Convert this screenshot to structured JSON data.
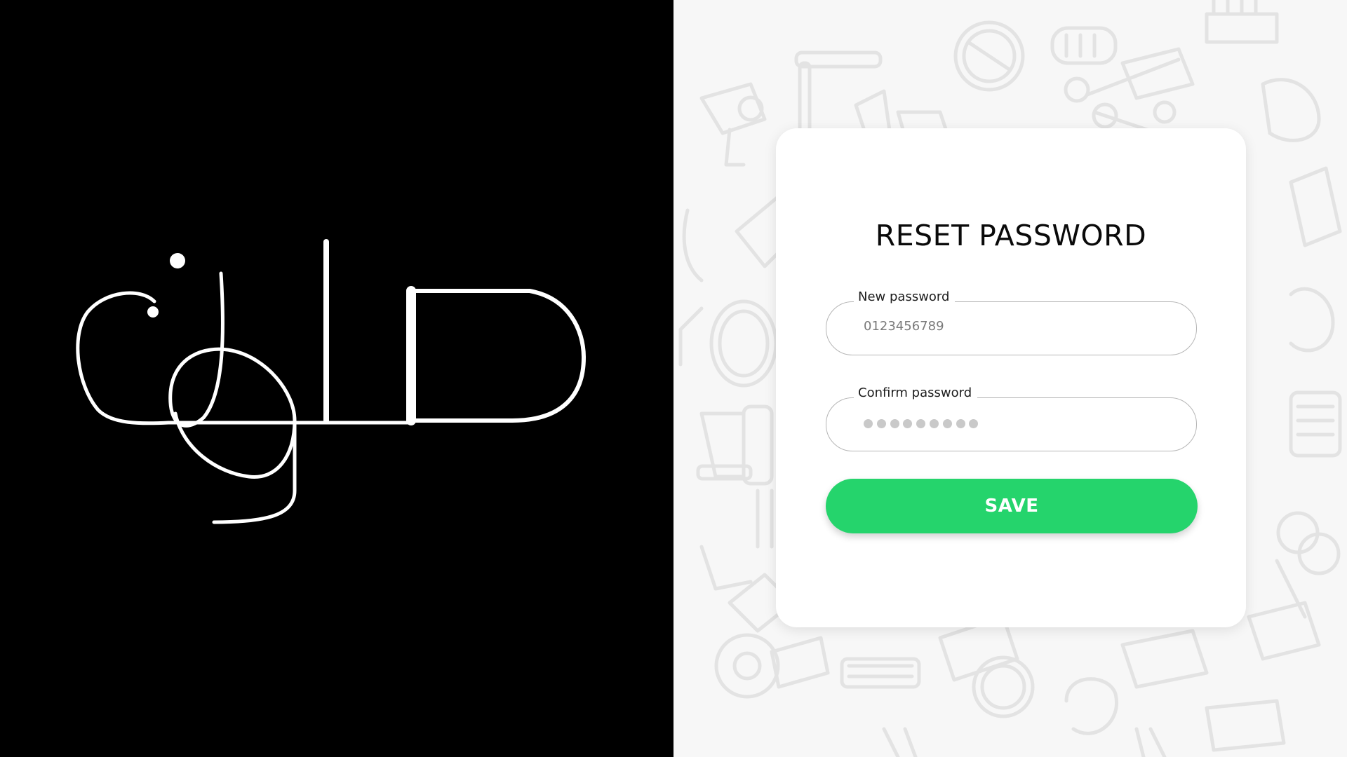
{
  "logo": {
    "name": "salon-arabic-calligraphy-logo",
    "text": "صالون",
    "color": "#ffffff",
    "background": "#000000"
  },
  "background": {
    "pattern": "barber-tools-doodle-pattern",
    "pattern_color": "#e6e6e6",
    "background_color": "#f7f7f7"
  },
  "form": {
    "title": "RESET PASSWORD",
    "new_password": {
      "label": "New password",
      "value": "0123456789"
    },
    "confirm_password": {
      "label": "Confirm password",
      "masked_dot_count": 9
    },
    "save_label": "SAVE",
    "accent_color": "#25d46c"
  }
}
